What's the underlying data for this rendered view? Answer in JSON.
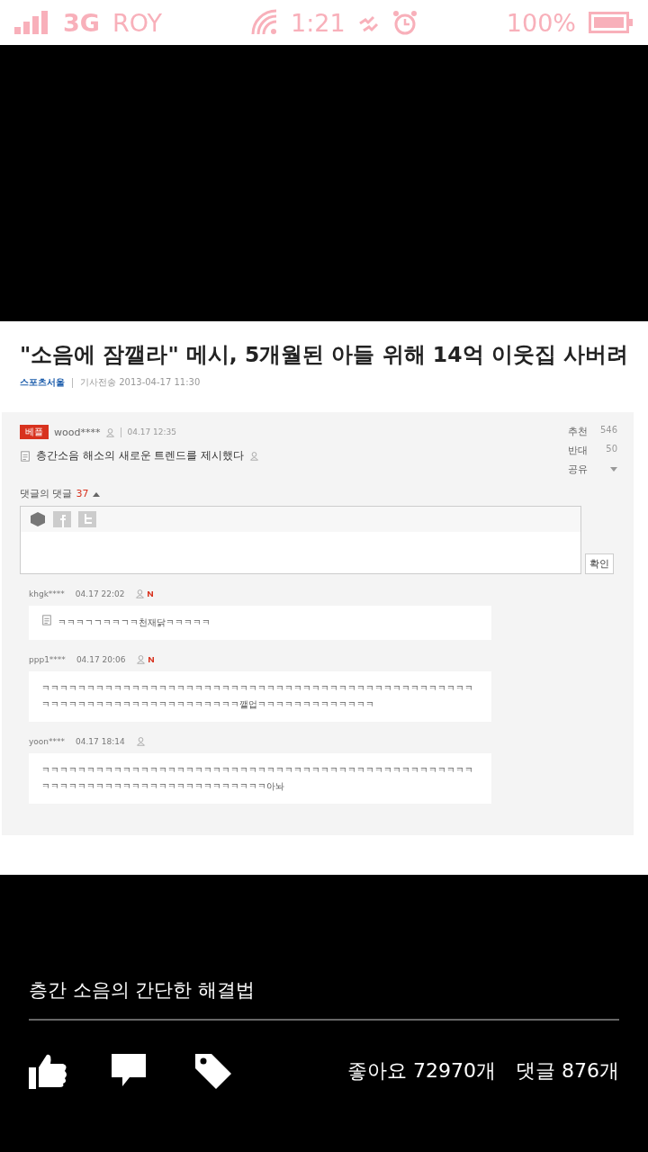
{
  "status_bar": {
    "network": "3G",
    "carrier": "ROY",
    "time": "1:21",
    "battery": "100%"
  },
  "article": {
    "title": "\"소음에 잠깰라\" 메시, 5개월된 아들 위해 14억 이웃집 사버려",
    "source": "스포츠서울",
    "meta": "기사전송 2013-04-17 11:30",
    "best_comment": {
      "badge": "베플",
      "user": "wood****",
      "time": "04.17 12:35",
      "text": "층간소음 해소의 새로운 트렌드를 제시했다"
    },
    "votes": [
      {
        "label": "추천",
        "count": "546"
      },
      {
        "label": "반대",
        "count": "50"
      }
    ],
    "share": "공유",
    "replies_label": "댓글의 댓글",
    "replies_count": "37",
    "submit": "확인",
    "replies": [
      {
        "user": "khgk****",
        "time": "04.17 22:02",
        "new": true,
        "memo": true,
        "text": "ㅋㅋㅋㄱㄱㅋㅋㄱㅋ천재닭ㅋㅋㅋㅋㅋ"
      },
      {
        "user": "ppp1****",
        "time": "04.17 20:06",
        "new": true,
        "memo": false,
        "text": "ㅋㅋㅋㅋㅋㅋㅋㅋㅋㅋㅋㅋㅋㅋㅋㅋㅋㅋㅋㅋㅋㅋㅋㅋㅋㅋㅋㅋㅋㅋㅋㅋㅋㅋㅋㅋㅋㅋㅋㅋㅋㅋㅋㅋㅋㅋㅋㅋㅋㅋㅋㅋㅋㅋㅋㅋㅋㅋㅋㅋㅋㅋㅋㅋㅋㅋㅋㅋㅋㅋ깰업ㅋㅋㅋㅋㅋㅋㅋㅋㅋㅋㅋㅋㅋ"
      },
      {
        "user": "yoon****",
        "time": "04.17 18:14",
        "new": false,
        "memo": false,
        "text": "ㅋㅋㅋㅋㅋㅋㅋㅋㅋㅋㅋㅋㅋㅋㅋㅋㅋㅋㅋㅋㅋㅋㅋㅋㅋㅋㅋㅋㅋㅋㅋㅋㅋㅋㅋㅋㅋㅋㅋㅋㅋㅋㅋㅋㅋㅋㅋㅋㅋㅋㅋㅋㅋㅋㅋㅋㅋㅋㅋㅋㅋㅋㅋㅋㅋㅋㅋㅋㅋㅋㅋㅋㅋ아놔"
      }
    ]
  },
  "caption": "층간 소음의 간단한 해결법",
  "likes": "좋아요 72970개",
  "comments": "댓글 876개"
}
